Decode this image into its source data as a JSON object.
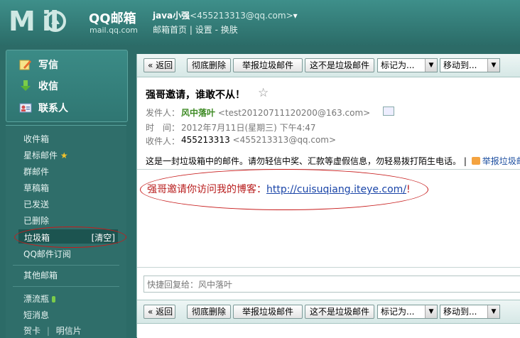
{
  "header": {
    "logo_text": "M  il",
    "brand": "QQ邮箱",
    "url": "mail.qq.com",
    "user_name": "java小强",
    "user_email": "<455213313@qq.com>",
    "dropdown_glyph": "▾",
    "links": [
      "邮箱首页",
      "设置",
      "换肤"
    ],
    "link_sep": "|",
    "link_dash": "-"
  },
  "sidebar": {
    "primary": [
      {
        "label": "写信",
        "icon": "pencil-icon"
      },
      {
        "label": "收信",
        "icon": "download-icon"
      },
      {
        "label": "联系人",
        "icon": "contacts-icon"
      }
    ],
    "folders": [
      "收件箱",
      "星标邮件",
      "群邮件",
      "草稿箱",
      "已发送",
      "已删除"
    ],
    "star_glyph": "★",
    "trash": {
      "label": "垃圾箱",
      "clear": "[清空]"
    },
    "qq_subscribe": "QQ邮件订阅",
    "other_mail": "其他邮箱",
    "drift_bottle": "漂流瓶",
    "sms": "短消息",
    "card": "贺卡",
    "card_sep": "|",
    "postcard": "明信片"
  },
  "toolbar": {
    "back": "« 返回",
    "delete": "彻底删除",
    "report": "举报垃圾邮件",
    "not_spam": "这不是垃圾邮件",
    "mark_as": "标记为...",
    "move_to": "移动到..."
  },
  "email": {
    "subject": "强哥邀请，谁敢不从！",
    "star_glyph": "☆",
    "from_label": "发件人：",
    "from_name": "风中落叶",
    "from_email": "<test20120711120200@163.com>",
    "time_label": "时　间：",
    "time": "2012年7月11日(星期三) 下午4:47",
    "to_label": "收件人：",
    "to_name": "455213313",
    "to_email": "<455213313@qq.com>",
    "spam_notice": "这是一封垃圾箱中的邮件。请勿轻信中奖、汇款等虚假信息，勿轻易拨打陌生电话。",
    "notice_sep": "|",
    "report_link": "举报垃圾邮件",
    "body_prefix": "强哥邀请你访问我的博客：",
    "body_link": "http://cuisuqiang.iteye.com/",
    "body_suffix": "!"
  },
  "reply": {
    "placeholder": "快捷回复给：风中落叶"
  },
  "colors": {
    "header_bg": "#2f7671",
    "sidebar_bg": "#2f6e6a",
    "annotation_red": "#c71b1b",
    "link_blue": "#1a45a8",
    "sender_green": "#3d8a23"
  }
}
